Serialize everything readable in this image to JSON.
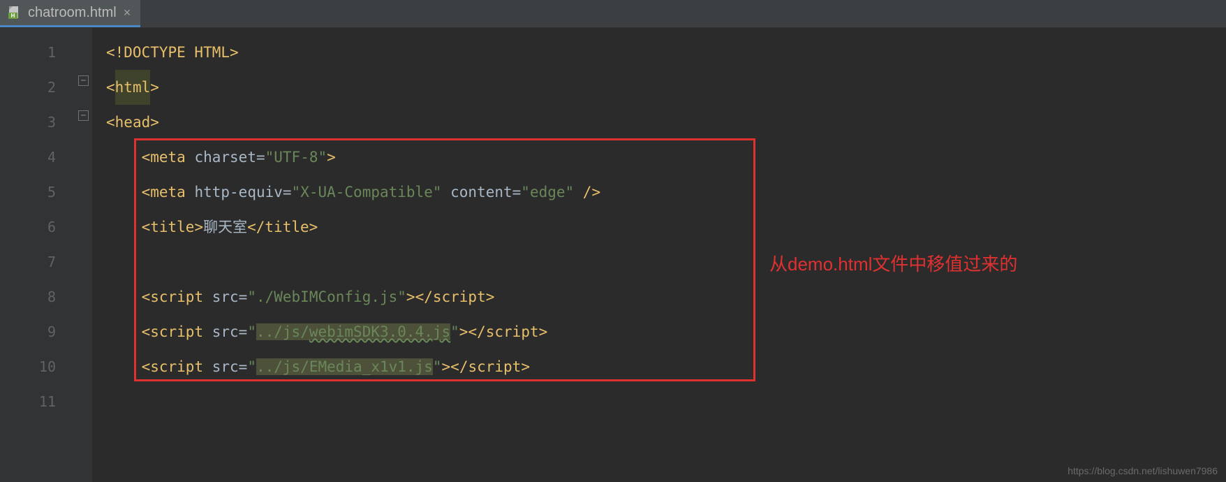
{
  "tab": {
    "filename": "chatroom.html"
  },
  "lines": [
    "1",
    "2",
    "3",
    "4",
    "5",
    "6",
    "7",
    "8",
    "9",
    "10",
    "11"
  ],
  "code": {
    "l1": {
      "doctype": "<!DOCTYPE HTML>"
    },
    "l2": {
      "open": "<",
      "tag": "html",
      "close": ">"
    },
    "l3": {
      "open": "<",
      "tag": "head",
      "close": ">"
    },
    "l4": {
      "open": "<",
      "tag": "meta",
      "sp": " ",
      "attr": "charset=",
      "val": "\"UTF-8\"",
      "close": ">"
    },
    "l5": {
      "open": "<",
      "tag": "meta",
      "sp": " ",
      "attr1": "http-equiv=",
      "val1": "\"X-UA-Compatible\"",
      "sp2": " ",
      "attr2": "content=",
      "val2": "\"edge\"",
      "close": " />"
    },
    "l6": {
      "open": "<",
      "tag": "title",
      "close": ">",
      "text": "聊天室",
      "copen": "</",
      "ctag": "title",
      "cclose": ">"
    },
    "l8": {
      "open": "<",
      "tag": "script",
      "sp": " ",
      "attr": "src=",
      "val": "\"./WebIMConfig.js\"",
      "close": ">",
      "copen": "</",
      "ctag": "script",
      "cclose": ">"
    },
    "l9": {
      "open": "<",
      "tag": "script",
      "sp": " ",
      "attr": "src=",
      "q1": "\"",
      "path": "../js/",
      "file": "webimSDK3.0.4.js",
      "q2": "\"",
      "close": ">",
      "copen": "</",
      "ctag": "script",
      "cclose": ">"
    },
    "l10": {
      "open": "<",
      "tag": "script",
      "sp": " ",
      "attr": "src=",
      "q1": "\"",
      "path": "../js/",
      "file": "EMedia_x1v1.js",
      "q2": "\"",
      "close": ">",
      "copen": "</",
      "ctag": "script",
      "cclose": ">"
    }
  },
  "annotation": "从demo.html文件中移值过来的",
  "watermark": "https://blog.csdn.net/lishuwen7986"
}
